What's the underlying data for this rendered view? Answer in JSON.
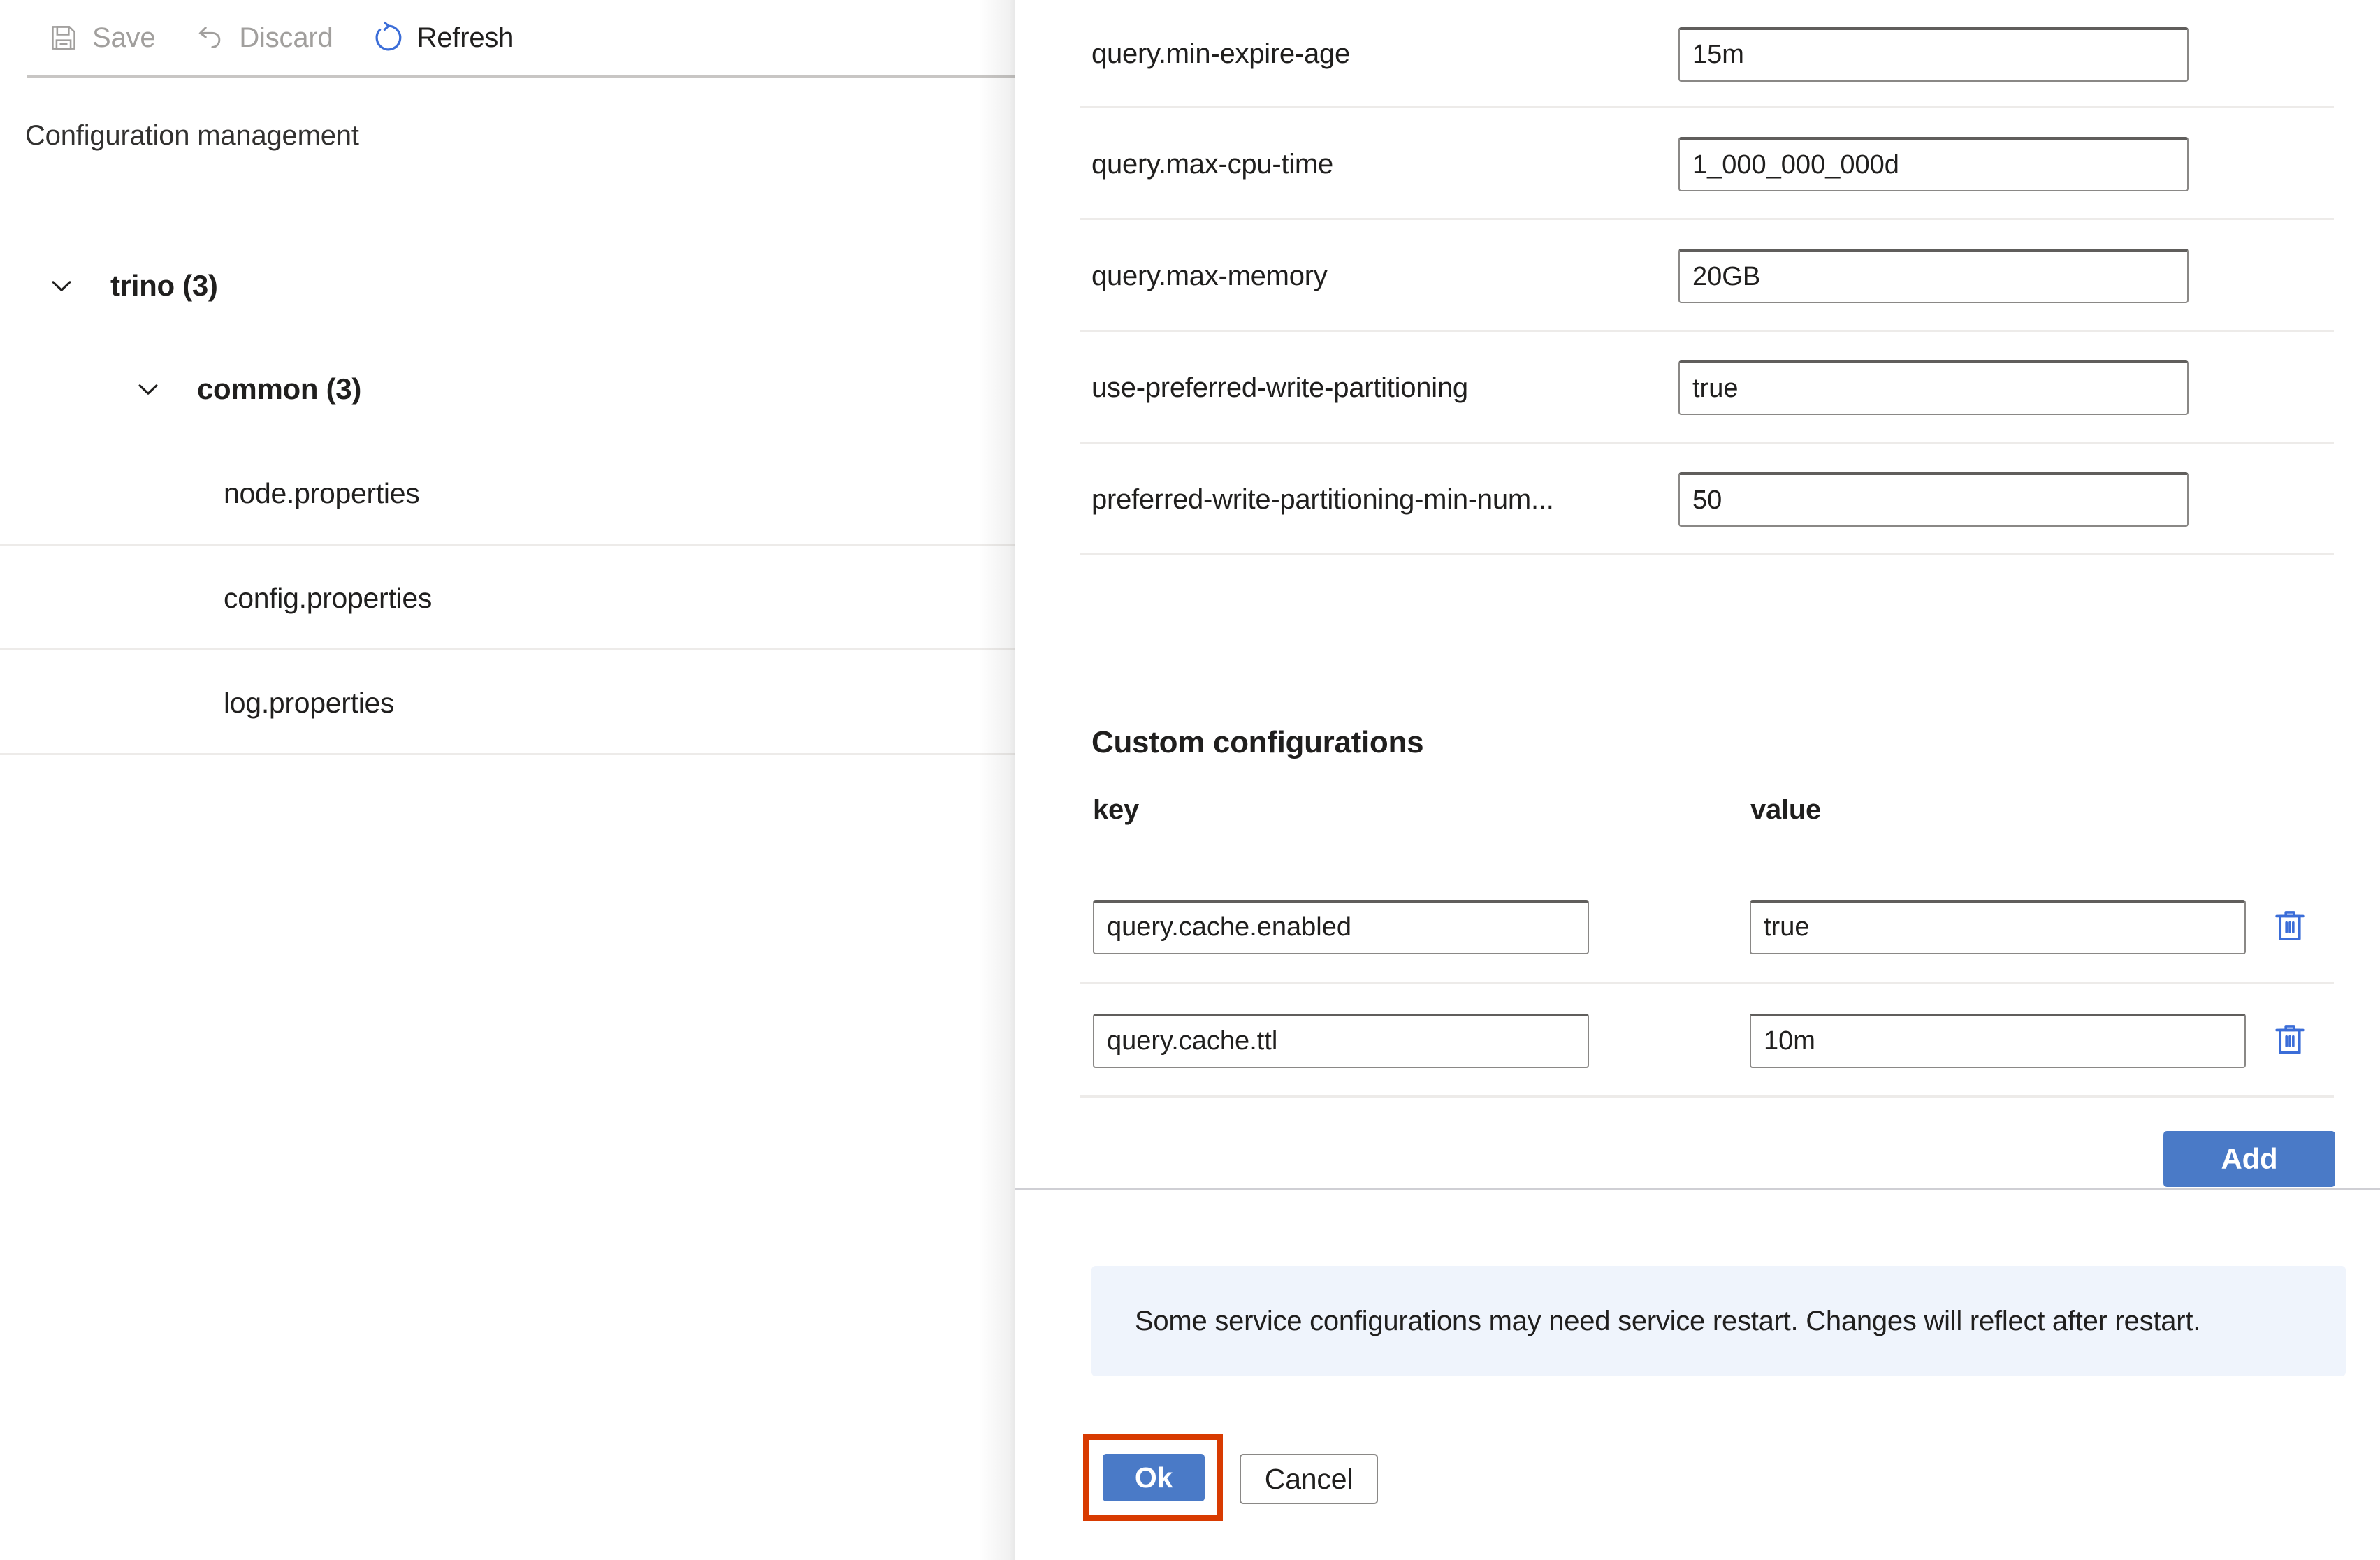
{
  "toolbar": {
    "save": {
      "label": "Save",
      "icon": "save-icon",
      "enabled": false
    },
    "discard": {
      "label": "Discard",
      "icon": "undo-icon",
      "enabled": false
    },
    "refresh": {
      "label": "Refresh",
      "icon": "refresh-icon",
      "enabled": true
    }
  },
  "left": {
    "title": "Configuration management",
    "tree": [
      {
        "label": "trino (3)",
        "level": 0,
        "expanded": true
      },
      {
        "label": "common (3)",
        "level": 1,
        "expanded": true
      },
      {
        "label": "node.properties",
        "level": 2
      },
      {
        "label": "config.properties",
        "level": 2
      },
      {
        "label": "log.properties",
        "level": 2
      }
    ]
  },
  "panel": {
    "configs": [
      {
        "label": "query.min-expire-age",
        "value": "15m"
      },
      {
        "label": "query.max-cpu-time",
        "value": "1_000_000_000d"
      },
      {
        "label": "query.max-memory",
        "value": "20GB"
      },
      {
        "label": "use-preferred-write-partitioning",
        "value": "true"
      },
      {
        "label": "preferred-write-partitioning-min-num...",
        "value": "50"
      }
    ],
    "custom": {
      "title": "Custom configurations",
      "col_key": "key",
      "col_value": "value",
      "rows": [
        {
          "key": "query.cache.enabled",
          "value": "true",
          "delete_icon": "trash-icon"
        },
        {
          "key": "query.cache.ttl",
          "value": "10m",
          "delete_icon": "trash-icon"
        }
      ],
      "add_label": "Add"
    },
    "info_message": "Some service configurations may need service restart. Changes will reflect after restart.",
    "ok_label": "Ok",
    "cancel_label": "Cancel"
  },
  "colors": {
    "accent_blue": "#4a7ac7",
    "icon_blue": "#3b6dd8",
    "focus_outline": "#d83b01",
    "info_bg": "#eff4fc",
    "disabled_text": "#a19f9d"
  }
}
